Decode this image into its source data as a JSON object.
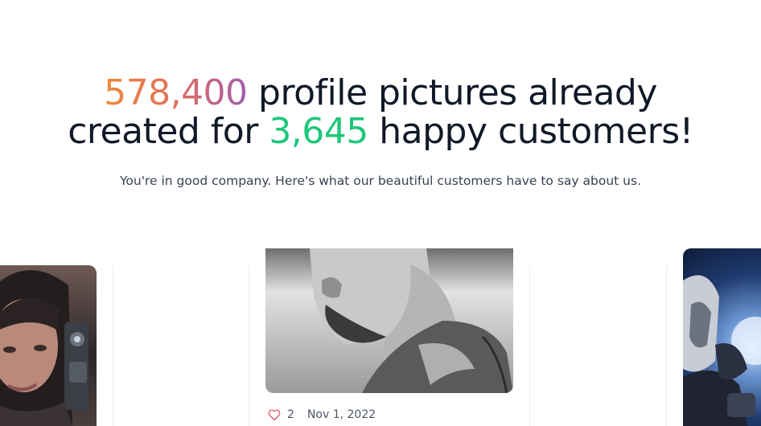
{
  "headline": {
    "profile_count": "578,400",
    "part1": " profile pictures already",
    "part2": "created for ",
    "customer_count": "3,645",
    "part3": " happy customers!"
  },
  "subheadline": "You're in good company. Here's what our beautiful customers have to say about us.",
  "testimonials": [
    {
      "image": "portrait-woman-headset"
    },
    {
      "image": "portrait-man-grayscale",
      "likes": "2",
      "date": "Nov 1, 2022",
      "like_icon": "heart-icon"
    },
    {
      "image": "portrait-robot-space"
    }
  ],
  "colors": {
    "gradient_start": "#f0883e",
    "gradient_end": "#a45cb0",
    "green": "#1fc77a",
    "heart": "#e0566e",
    "text_dark": "#111827"
  }
}
